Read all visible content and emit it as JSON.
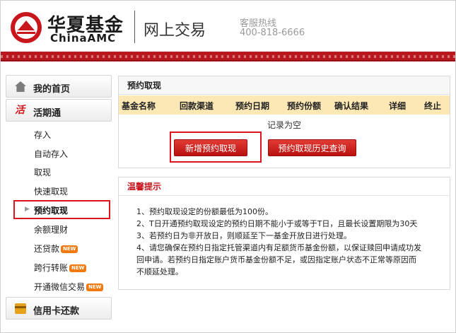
{
  "header": {
    "brand_cn": "华夏基金",
    "brand_en": "ChinaAMC",
    "site_title": "网上交易",
    "hotline_label": "客服热线",
    "hotline_number": "400-818-6666"
  },
  "sidebar": {
    "home_label": "我的首页",
    "huoqi_label": "活期通",
    "items": [
      {
        "label": "存入",
        "badge": ""
      },
      {
        "label": "自动存入",
        "badge": ""
      },
      {
        "label": "取现",
        "badge": ""
      },
      {
        "label": "快速取现",
        "badge": ""
      },
      {
        "label": "预约取现",
        "badge": ""
      },
      {
        "label": "余额理财",
        "badge": ""
      },
      {
        "label": "还贷款",
        "badge": "NEW"
      },
      {
        "label": "跨行转账",
        "badge": "NEW"
      },
      {
        "label": "开通微信交易",
        "badge": "NEW"
      }
    ],
    "credit_label": "信用卡还款"
  },
  "reservation": {
    "title": "预约取现",
    "columns": [
      "基金名称",
      "回款渠道",
      "预约日期",
      "预约份额",
      "确认结果",
      "详细",
      "终止"
    ],
    "empty_text": "记录为空",
    "new_button": "新增预约取现",
    "history_button": "预约取现历史查询"
  },
  "tips": {
    "title": "温馨提示",
    "lines": [
      "1、预约取现设定的份额最低为100份。",
      "2、T日开通预约取现设定的预约日期不能小于或等于T日，且最长设置期限为30天",
      "3、若预约日为非开放日，则顺延至下一基金开放日进行处理。",
      "4、请您确保在预约日指定托管渠道内有足额货币基金份额，以保证赎回申请成功发",
      "回申请。若预约日指定账户货币基金份额不足，或因指定账户状态不正常等原因而",
      "不顺延处理。"
    ]
  },
  "colors": {
    "brand_red": "#c9161d",
    "header_row": "#fbe8b5",
    "badge_orange": "#f07a10"
  }
}
